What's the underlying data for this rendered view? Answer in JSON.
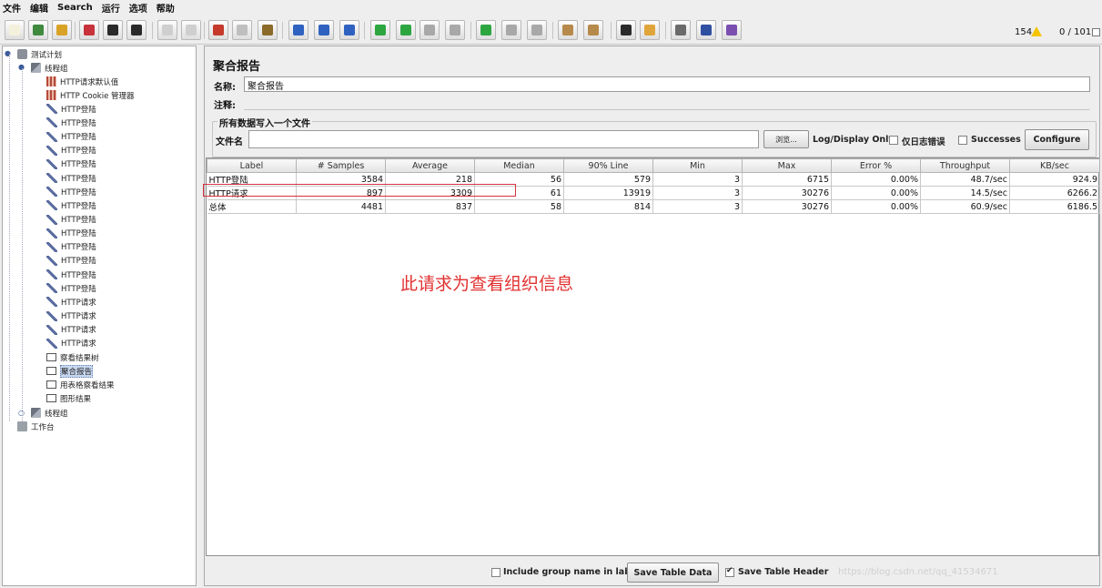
{
  "menu": [
    "文件",
    "编辑",
    "Search",
    "运行",
    "选项",
    "帮助"
  ],
  "toolbar": {
    "warnings_count": "154",
    "threads_count": "0 / 101",
    "buttons": [
      {
        "name": "new-icon",
        "color": "#f3f0dc"
      },
      {
        "name": "templates-icon",
        "color": "#3f8a3f"
      },
      {
        "name": "open-icon",
        "color": "#d9a227"
      },
      {
        "name": "close-icon",
        "color": "#c8323a"
      },
      {
        "name": "save-icon",
        "color": "#2a2a2a"
      },
      {
        "name": "save-as-icon",
        "color": "#2a2a2a"
      },
      {
        "name": "undo-icon",
        "color": "#cfcfcf"
      },
      {
        "name": "redo-icon",
        "color": "#cfcfcf"
      },
      {
        "name": "cut-icon",
        "color": "#c53a2b"
      },
      {
        "name": "copy-icon",
        "color": "#bfbfbf"
      },
      {
        "name": "paste-icon",
        "color": "#8c6b2a"
      },
      {
        "name": "expand-icon",
        "color": "#2f62c0"
      },
      {
        "name": "collapse-icon",
        "color": "#2f62c0"
      },
      {
        "name": "toggle-icon",
        "color": "#2f62c0"
      },
      {
        "name": "start-icon",
        "color": "#2da640"
      },
      {
        "name": "start-no-pause-icon",
        "color": "#2da640"
      },
      {
        "name": "stop-icon",
        "color": "#a8a8a8"
      },
      {
        "name": "shutdown-icon",
        "color": "#a8a8a8"
      },
      {
        "name": "remote-start-icon",
        "color": "#2da640"
      },
      {
        "name": "remote-stop-icon",
        "color": "#a8a8a8"
      },
      {
        "name": "remote-shutdown-icon",
        "color": "#a8a8a8"
      },
      {
        "name": "clear-icon",
        "color": "#b68a4a"
      },
      {
        "name": "clear-all-icon",
        "color": "#b68a4a"
      },
      {
        "name": "search-icon",
        "color": "#2a2a2a"
      },
      {
        "name": "reset-search-icon",
        "color": "#e0a53a"
      },
      {
        "name": "function-helper-icon",
        "color": "#6a6a6a"
      },
      {
        "name": "help-icon",
        "color": "#2f4fa0"
      },
      {
        "name": "log-viewer-icon",
        "color": "#7a4fb0"
      }
    ]
  },
  "tree": {
    "test_plan": "测试计划",
    "thread_group": "线程组",
    "children": [
      {
        "label": "HTTP请求默认值",
        "type": "config"
      },
      {
        "label": "HTTP Cookie 管理器",
        "type": "config"
      },
      {
        "label": "HTTP登陆",
        "type": "sampler"
      },
      {
        "label": "HTTP登陆",
        "type": "sampler"
      },
      {
        "label": "HTTP登陆",
        "type": "sampler"
      },
      {
        "label": "HTTP登陆",
        "type": "sampler"
      },
      {
        "label": "HTTP登陆",
        "type": "sampler"
      },
      {
        "label": "HTTP登陆",
        "type": "sampler"
      },
      {
        "label": "HTTP登陆",
        "type": "sampler"
      },
      {
        "label": "HTTP登陆",
        "type": "sampler"
      },
      {
        "label": "HTTP登陆",
        "type": "sampler"
      },
      {
        "label": "HTTP登陆",
        "type": "sampler"
      },
      {
        "label": "HTTP登陆",
        "type": "sampler"
      },
      {
        "label": "HTTP登陆",
        "type": "sampler"
      },
      {
        "label": "HTTP登陆",
        "type": "sampler"
      },
      {
        "label": "HTTP登陆",
        "type": "sampler"
      },
      {
        "label": "HTTP请求",
        "type": "sampler"
      },
      {
        "label": "HTTP请求",
        "type": "sampler"
      },
      {
        "label": "HTTP请求",
        "type": "sampler"
      },
      {
        "label": "HTTP请求",
        "type": "sampler"
      },
      {
        "label": "察看结果树",
        "type": "listener"
      },
      {
        "label": "聚合报告",
        "type": "listener",
        "selected": true
      },
      {
        "label": "用表格察看结果",
        "type": "listener"
      },
      {
        "label": "图形结果",
        "type": "listener"
      }
    ],
    "thread_group_2": "线程组",
    "workbench": "工作台"
  },
  "panel": {
    "title": "聚合报告",
    "name_label": "名称:",
    "name_value": "聚合报告",
    "comment_label": "注释:",
    "comment_value": "",
    "file_section": "所有数据写入一个文件",
    "filename_label": "文件名",
    "filename_value": "",
    "browse_label": "浏览...",
    "log_display_label": "Log/Display Only:",
    "errors_only_label": "仅日志错误",
    "successes_label": "Successes",
    "configure_label": "Configure"
  },
  "table": {
    "headers": [
      "Label",
      "# Samples",
      "Average",
      "Median",
      "90% Line",
      "Min",
      "Max",
      "Error %",
      "Throughput",
      "KB/sec"
    ],
    "rows": [
      [
        "HTTP登陆",
        "3584",
        "218",
        "56",
        "579",
        "3",
        "6715",
        "0.00%",
        "48.7/sec",
        "924.9"
      ],
      [
        "HTTP请求",
        "897",
        "3309",
        "61",
        "13919",
        "3",
        "30276",
        "0.00%",
        "14.5/sec",
        "6266.2"
      ],
      [
        "总体",
        "4481",
        "837",
        "58",
        "814",
        "3",
        "30276",
        "0.00%",
        "60.9/sec",
        "6186.5"
      ]
    ]
  },
  "annotation": "此请求为查看组织信息",
  "footer": {
    "include_group_label": "Include group name in label?",
    "include_group_checked": false,
    "save_table_data_label": "Save Table Data",
    "save_header_label": "Save Table Header",
    "save_header_checked": true
  },
  "watermark": "https://blog.csdn.net/qq_41534671"
}
